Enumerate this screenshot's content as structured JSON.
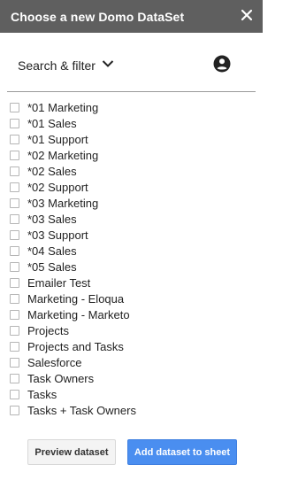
{
  "header": {
    "title": "Choose a new Domo DataSet",
    "close_icon": "close-icon",
    "background": "#5f5f5f"
  },
  "toolbar": {
    "filter_label": "Search & filter",
    "filter_icon": "chevron-down-icon",
    "account_icon": "account-circle-icon"
  },
  "datasets": [
    {
      "label": "*01 Marketing",
      "checked": false
    },
    {
      "label": "*01 Sales",
      "checked": false
    },
    {
      "label": "*01 Support",
      "checked": false
    },
    {
      "label": "*02 Marketing",
      "checked": false
    },
    {
      "label": "*02 Sales",
      "checked": false
    },
    {
      "label": "*02 Support",
      "checked": false
    },
    {
      "label": "*03 Marketing",
      "checked": false
    },
    {
      "label": "*03 Sales",
      "checked": false
    },
    {
      "label": "*03 Support",
      "checked": false
    },
    {
      "label": "*04 Sales",
      "checked": false
    },
    {
      "label": "*05 Sales",
      "checked": false
    },
    {
      "label": "Emailer Test",
      "checked": false
    },
    {
      "label": "Marketing - Eloqua",
      "checked": false
    },
    {
      "label": "Marketing - Marketo",
      "checked": false
    },
    {
      "label": "Projects",
      "checked": false
    },
    {
      "label": "Projects and Tasks",
      "checked": false
    },
    {
      "label": "Salesforce",
      "checked": false
    },
    {
      "label": "Task Owners",
      "checked": false
    },
    {
      "label": "Tasks",
      "checked": false
    },
    {
      "label": "Tasks + Task Owners",
      "checked": false
    }
  ],
  "footer": {
    "preview_label": "Preview dataset",
    "add_label": "Add dataset to sheet",
    "primary_color": "#4a8ef0"
  }
}
